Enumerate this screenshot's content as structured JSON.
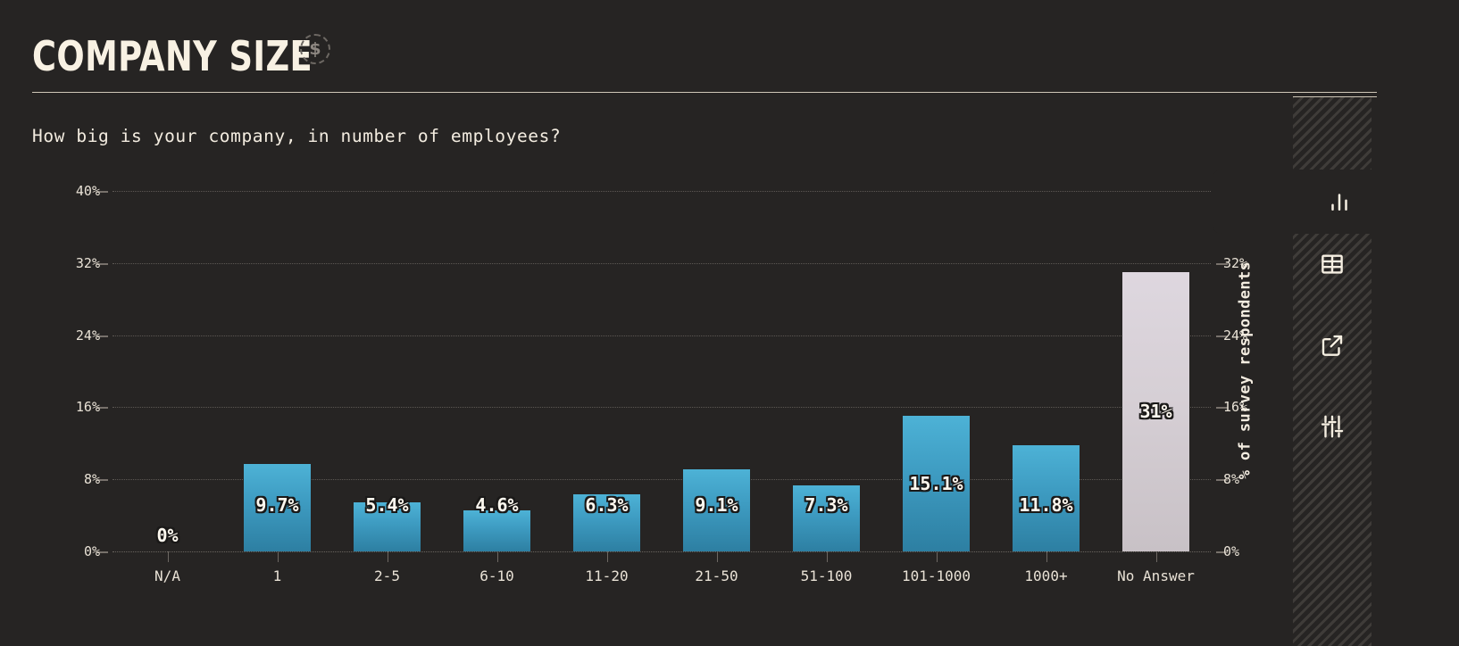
{
  "header": {
    "title": "COMPANY SIZE",
    "badge_icon": "dollar-sign-icon",
    "badge_symbol": "$"
  },
  "question": "How big is your company, in number of employees?",
  "axis_title": "% of survey respondents",
  "colors": {
    "background": "#262423",
    "text": "#f3ece0",
    "bar_top": "#4db2d6",
    "bar_bottom": "#2d7fa2",
    "bar_alt_top": "#ded7df",
    "bar_alt_bottom": "#c8c1c6",
    "grid": "#5d5854",
    "rule": "#cfc7b8"
  },
  "toolbar": {
    "items": [
      {
        "name": "chart-view",
        "icon": "bar-chart-icon",
        "active": true
      },
      {
        "name": "table-view",
        "icon": "table-grid-icon",
        "active": false
      },
      {
        "name": "open-external",
        "icon": "external-link-icon",
        "active": false
      },
      {
        "name": "filter-settings",
        "icon": "sliders-icon",
        "active": false
      }
    ]
  },
  "chart_data": {
    "type": "bar",
    "title": "COMPANY SIZE",
    "subtitle": "How big is your company, in number of employees?",
    "xlabel": "",
    "ylabel": "% of survey respondents",
    "ylim": [
      0,
      40
    ],
    "grid": true,
    "legend": "none",
    "yticks": [
      "0%",
      "8%",
      "16%",
      "24%",
      "32%",
      "40%"
    ],
    "ytick_values": [
      0,
      8,
      16,
      24,
      32,
      40
    ],
    "categories": [
      "N/A",
      "1",
      "2-5",
      "6-10",
      "11-20",
      "21-50",
      "51-100",
      "101-1000",
      "1000+",
      "No Answer"
    ],
    "values": [
      0,
      9.7,
      5.4,
      4.6,
      6.3,
      9.1,
      7.3,
      15.1,
      11.8,
      31
    ],
    "value_labels": [
      "0%",
      "9.7%",
      "5.4%",
      "4.6%",
      "6.3%",
      "9.1%",
      "7.3%",
      "15.1%",
      "11.8%",
      "31%"
    ],
    "bar_styles": [
      "zero",
      "primary",
      "primary",
      "primary",
      "primary",
      "primary",
      "primary",
      "primary",
      "primary",
      "alt"
    ]
  }
}
